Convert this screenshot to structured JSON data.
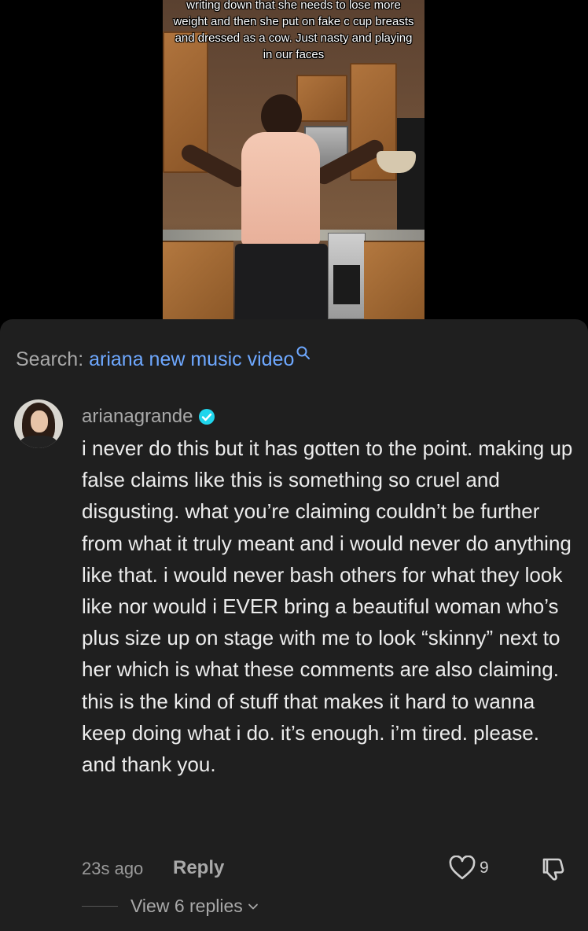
{
  "video": {
    "overlay_caption": "writing down that she needs to lose more weight and then she put on fake c cup breasts and dressed as a cow. Just nasty and playing in our faces"
  },
  "search": {
    "prefix": "Search: ",
    "term": "ariana new music video"
  },
  "comment": {
    "username": "arianagrande",
    "verified": true,
    "body": "i never do this but it has gotten to the point. making up false claims like this is something so cruel and disgusting. what you’re claiming couldn’t be further from what it truly meant and i would never do anything like that. i would never bash others for what they look like nor would i EVER bring a beautiful woman who’s plus size up on stage with me to look “skinny” next to her which is what these comments are also claiming. this is the kind of stuff that makes it hard to wanna keep doing what i do. it’s enough. i’m tired. please. and thank you.",
    "timestamp": "23s ago",
    "reply_label": "Reply",
    "like_count": "9",
    "view_replies_label": "View 6 replies"
  },
  "colors": {
    "sheet_bg": "#1f1f1f",
    "link_blue": "#6ea8ff",
    "verified_blue": "#20d5ec"
  }
}
